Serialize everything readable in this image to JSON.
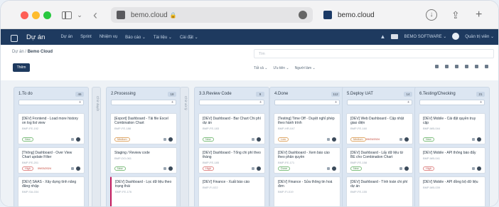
{
  "browser": {
    "address": "bemo.cloud",
    "lock_icon": "lock-icon",
    "tab_title": "bemo.cloud"
  },
  "navbar": {
    "brand": "Dự án",
    "menu": [
      "Dự án",
      "Sprint",
      "Nhiệm vụ",
      "Báo cáo ⌄",
      "Tài liệu ⌄",
      "Cài đặt ⌄"
    ],
    "user_label": "Quản trị viên ⌄",
    "org_label": "BEMO SOFTWARE ⌄"
  },
  "subheader": {
    "breadcrumb_parent": "Dự án",
    "breadcrumb_current": "Bemo Cloud",
    "filter_placeholder": "Tìm",
    "primary_button": "Thêm",
    "filters": [
      "Tất cả ⌄",
      "Ưu tiên ⌄",
      "Người làm ⌄"
    ]
  },
  "columns": [
    {
      "title": "1.To do",
      "count": "46",
      "cards": [
        {
          "title": "[DEV] Frontend - Load more history on log list view",
          "code": "BMP-FE-192",
          "tag": "New",
          "tag_class": "",
          "date": ""
        },
        {
          "title": "[Thông] Dashboard - Over View Chart update Filter",
          "code": "BMP-FE-201",
          "tag": "High",
          "tag_class": "red",
          "date": "09/03/2024"
        },
        {
          "title": "[DEV] SAAS - Xây dựng tính năng đăng nhập",
          "code": "BMP-SA-034",
          "tag": "",
          "tag_class": "",
          "date": ""
        }
      ]
    },
    {
      "title": "2.Processing",
      "count": "18",
      "cards": [
        {
          "title": "[Export] Dashboard - Tải file Excel Combination Chart",
          "code": "BMP-FE-188",
          "tag": "Medium",
          "tag_class": "warn",
          "date": ""
        },
        {
          "title": "Staging / Review code",
          "code": "BMP-DO-061",
          "tag": "New",
          "tag_class": "",
          "date": ""
        },
        {
          "title": "[DEV] Dashboard - Lọc dữ liệu theo trạng thái",
          "code": "BMP-FE-176",
          "tag": "",
          "tag_class": "",
          "date": ""
        }
      ]
    },
    {
      "title": "3.3.Review Code",
      "count": "9",
      "cards": [
        {
          "title": "[DEV] Dashboard - Bar Chart Chi phí dự án",
          "code": "BMP-FE-183",
          "tag": "New",
          "tag_class": "",
          "date": ""
        },
        {
          "title": "[DEV] Dashboard - Tổng chi phí theo tháng",
          "code": "BMP-FE-185",
          "tag": "High",
          "tag_class": "red",
          "date": ""
        },
        {
          "title": "[DEV] Finance - Xuất báo cáo",
          "code": "BMP-FI-022",
          "tag": "",
          "tag_class": "",
          "date": ""
        }
      ]
    },
    {
      "title": "4.Done",
      "count": "112",
      "cards": [
        {
          "title": "[Testing] Time Off - Duyệt nghỉ phép theo hành trình",
          "code": "BMP-HR-047",
          "tag": "Low",
          "tag_class": "warn",
          "date": ""
        },
        {
          "title": "[DEV] Dashboard - Xem báo cáo theo phân quyền",
          "code": "BMP-FE-171",
          "tag": "Done",
          "tag_class": "",
          "date": ""
        },
        {
          "title": "[DEV] Finance - Sửa thông tin hoá đơn",
          "code": "BMP-FI-019",
          "tag": "",
          "tag_class": "",
          "date": ""
        }
      ]
    },
    {
      "title": "5.Deploy UAT",
      "count": "14",
      "cards": [
        {
          "title": "[DEV] Web Dashboard - Cập nhật giao diện",
          "code": "BMP-FE-160",
          "tag": "Medium",
          "tag_class": "warn",
          "date": "09/03/2024"
        },
        {
          "title": "[DEV] Dashboard - Lấy dữ liệu từ BE cho Combination Chart",
          "code": "BMP-FE-158",
          "tag": "New",
          "tag_class": "",
          "date": ""
        },
        {
          "title": "[DEV] Dashboard - Tính toán chi phí dự án",
          "code": "BMP-FE-155",
          "tag": "",
          "tag_class": "",
          "date": ""
        }
      ]
    },
    {
      "title": "6.Testing/Checking",
      "count": "21",
      "cards": [
        {
          "title": "[DEV] Mobile - Cài đặt quyền truy cập",
          "code": "BMP-MB-044",
          "tag": "New",
          "tag_class": "",
          "date": ""
        },
        {
          "title": "[DEV] Mobile - API thông báo đẩy",
          "code": "BMP-MB-041",
          "tag": "High",
          "tag_class": "red",
          "date": ""
        },
        {
          "title": "[DEV] Mobile - API đồng bộ dữ liệu",
          "code": "BMP-MB-039",
          "tag": "",
          "tag_class": "",
          "date": ""
        }
      ]
    }
  ],
  "collapsed": [
    "Chờ duyệt",
    "Chờ xử lý"
  ],
  "colors": {
    "navbar": "#1e3a5f",
    "column_bg": "#dce6f2",
    "accent": "#c2185b"
  }
}
